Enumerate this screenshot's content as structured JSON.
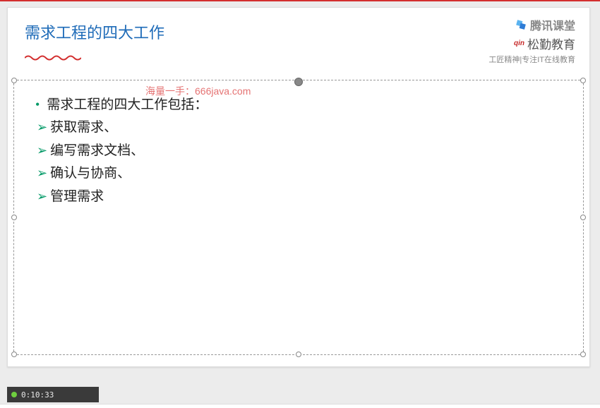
{
  "header": {
    "title": "需求工程的四大工作",
    "tencent_label": "腾讯课堂",
    "songqin_label": "松勤教育",
    "songqin_script": "qin",
    "subtitle": "工匠精神|专注IT在线教育"
  },
  "watermark": "海量一手：666java.com",
  "content": {
    "main": "需求工程的四大工作包括：",
    "items": [
      "获取需求、",
      "编写需求文档、",
      "确认与协商、",
      "管理需求"
    ]
  },
  "player": {
    "timestamp": "0:10:33"
  }
}
